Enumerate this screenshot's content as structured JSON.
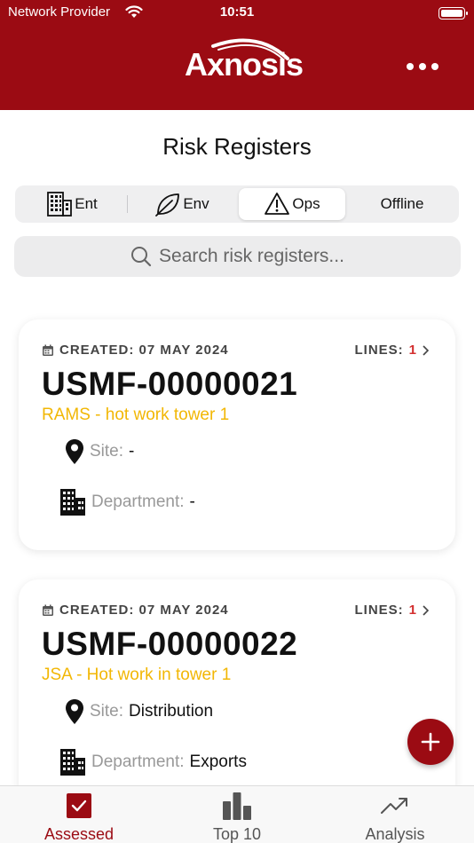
{
  "status_bar": {
    "provider": "Network Provider",
    "time": "10:51"
  },
  "header": {
    "logo_text": "Axnosis"
  },
  "page": {
    "title": "Risk Registers"
  },
  "segments": [
    {
      "label": "Ent",
      "icon": "building-icon",
      "active": false
    },
    {
      "label": "Env",
      "icon": "leaf-icon",
      "active": false
    },
    {
      "label": "Ops",
      "icon": "warning-icon",
      "active": true
    },
    {
      "label": "Offline",
      "icon": "",
      "active": false
    }
  ],
  "search": {
    "placeholder": "Search risk registers..."
  },
  "registers": [
    {
      "created": "CREATED: 07 MAY 2024",
      "lines_label": "LINES:",
      "lines_count": "1",
      "id": "USMF-00000021",
      "description": "RAMS - hot work tower 1",
      "site_label": "Site:",
      "site_value": "-",
      "department_label": "Department:",
      "department_value": "-"
    },
    {
      "created": "CREATED: 07 MAY 2024",
      "lines_label": "LINES:",
      "lines_count": "1",
      "id": "USMF-00000022",
      "description": "JSA - Hot work in tower 1",
      "site_label": "Site:",
      "site_value": "Distribution",
      "department_label": "Department:",
      "department_value": "Exports"
    }
  ],
  "tabs": [
    {
      "label": "Assessed",
      "icon": "checkbox-icon",
      "active": true
    },
    {
      "label": "Top 10",
      "icon": "bar-chart-icon",
      "active": false
    },
    {
      "label": "Analysis",
      "icon": "trend-up-icon",
      "active": false
    }
  ],
  "colors": {
    "brand": "#9b0b13",
    "accent_text": "#f2b705",
    "count": "#d32f2f"
  }
}
